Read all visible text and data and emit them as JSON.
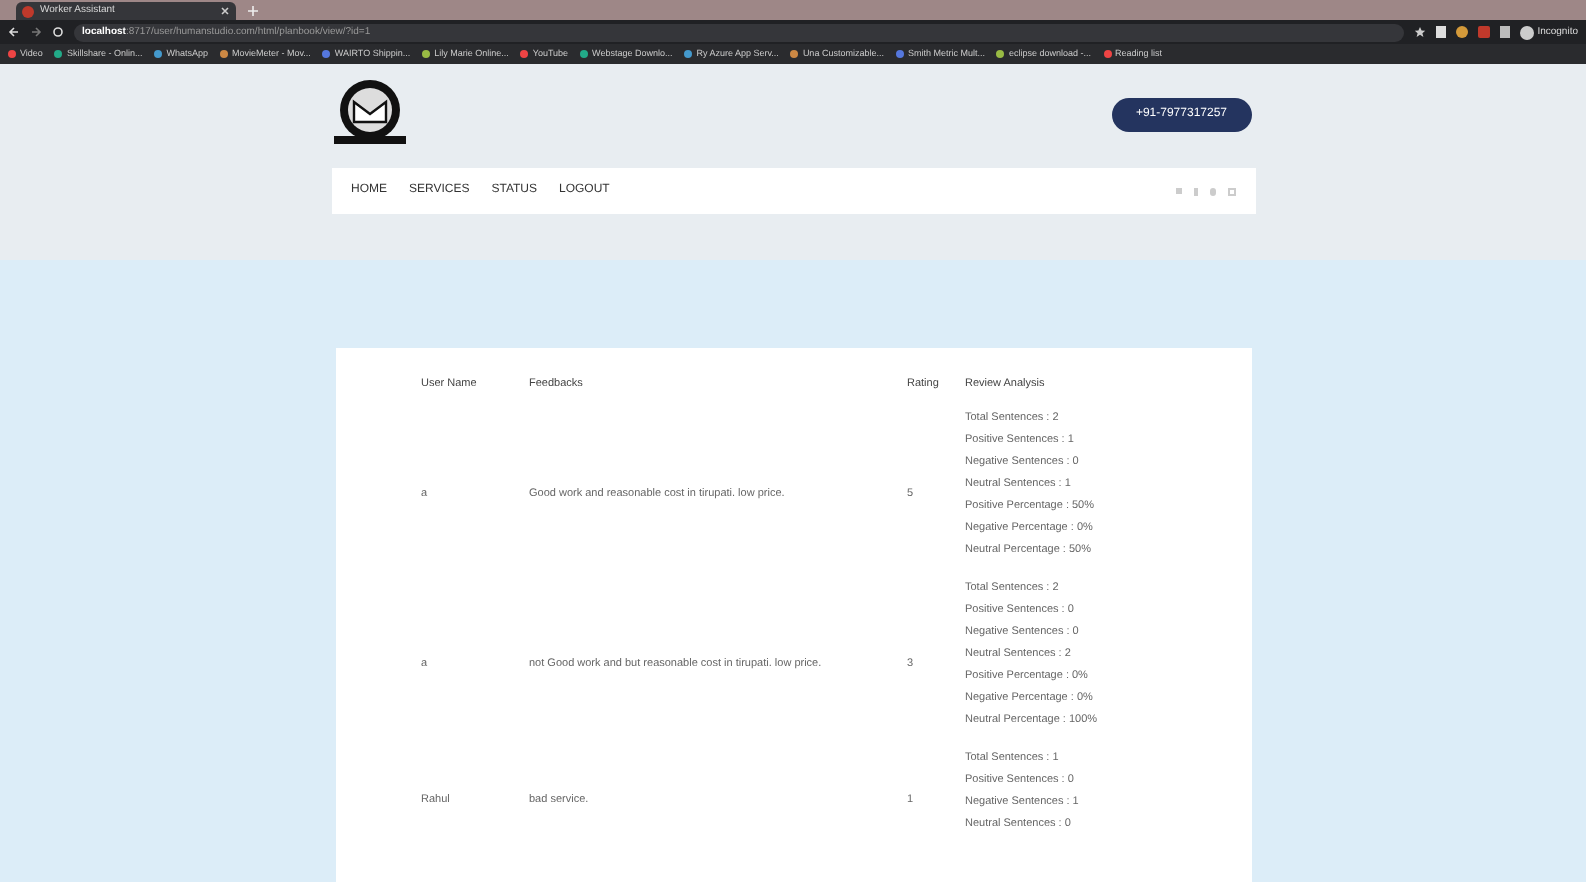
{
  "browser": {
    "tab_title": "Worker Assistant",
    "url_host": "localhost",
    "url_path": ":8717/user/humanstudio.com/html/planbook/view/?id=1",
    "profile": "Incognito",
    "bookmarks": [
      "Video",
      "Skillshare - Onlin...",
      "WhatsApp",
      "MovieMeter - Mov...",
      "WAIRTO Shippin...",
      "Lily Marie Online...",
      "YouTube",
      "Webstage Downlo...",
      "Ry Azure App Serv...",
      "Una Customizable...",
      "Smith Metric Mult...",
      "eclipse download -...",
      "Reading list"
    ]
  },
  "header": {
    "phone": "+91-7977317257"
  },
  "nav": [
    {
      "label": "HOME"
    },
    {
      "label": "SERVICES"
    },
    {
      "label": "STATUS"
    },
    {
      "label": "LOGOUT"
    }
  ],
  "table": {
    "columns": [
      "User Name",
      "Feedbacks",
      "Rating",
      "Review Analysis"
    ],
    "rows": [
      {
        "user": "a",
        "feedback": "Good work and reasonable cost in tirupati. low price.",
        "rating": "5",
        "analysis": [
          "Total Sentences : 2",
          "Positive Sentences : 1",
          "Negative Sentences : 0",
          "Neutral Sentences : 1",
          "Positive Percentage : 50%",
          "Negative Percentage : 0%",
          "Neutral Percentage : 50%"
        ]
      },
      {
        "user": "a",
        "feedback": "not Good work and but reasonable cost in tirupati. low price.",
        "rating": "3",
        "analysis": [
          "Total Sentences : 2",
          "Positive Sentences : 0",
          "Negative Sentences : 0",
          "Neutral Sentences : 2",
          "Positive Percentage : 0%",
          "Negative Percentage : 0%",
          "Neutral Percentage : 100%"
        ]
      },
      {
        "user": "Rahul",
        "feedback": "bad service.",
        "rating": "1",
        "analysis": [
          "Total Sentences : 1",
          "Positive Sentences : 0",
          "Negative Sentences : 1",
          "Neutral Sentences : 0"
        ]
      }
    ]
  }
}
